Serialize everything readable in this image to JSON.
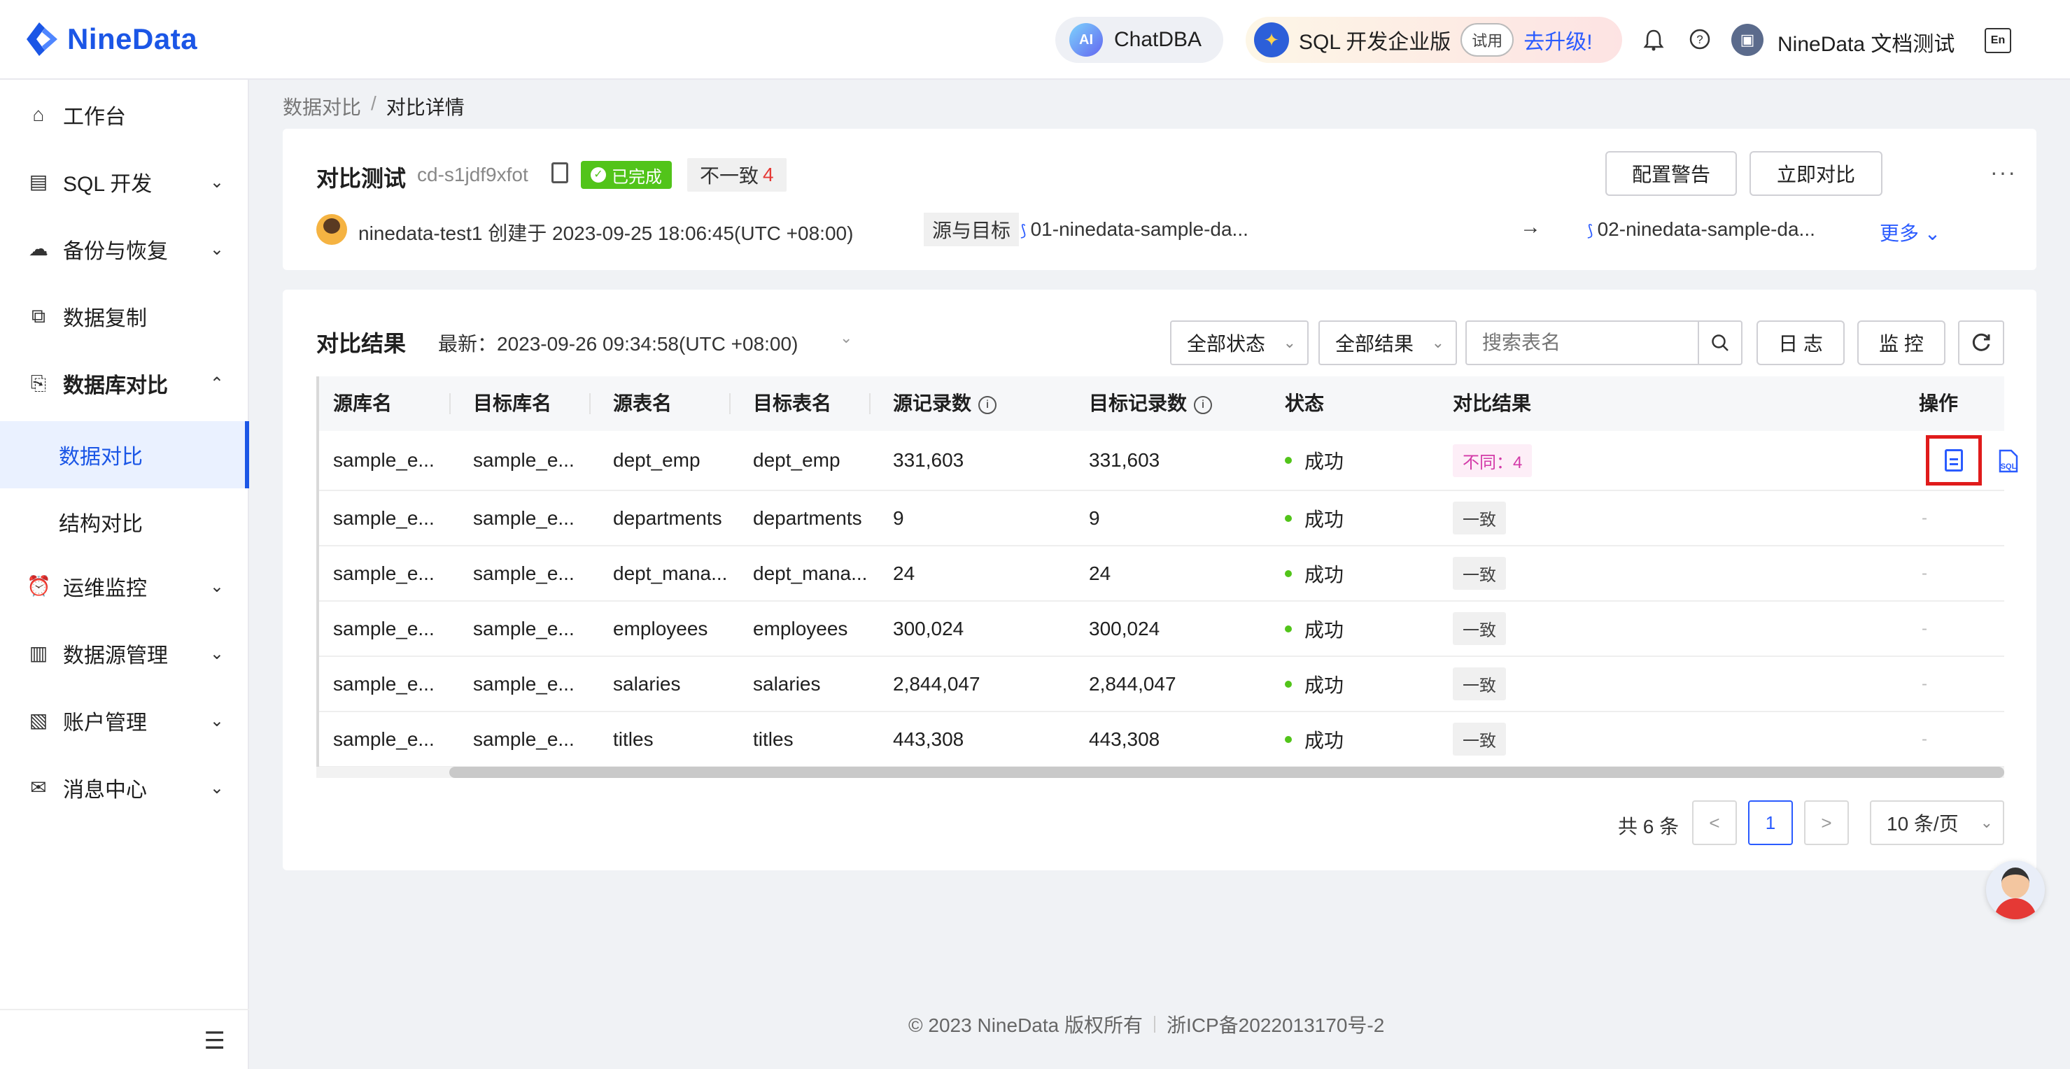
{
  "brand": {
    "name": "NineData"
  },
  "header": {
    "chatdba_label": "ChatDBA",
    "ai_badge": "AI",
    "edition_label": "SQL 开发企业版",
    "trial_tag": "试用",
    "upgrade_link": "去升级!",
    "user_name": "NineData 文档测试",
    "lang_icon_text": "En"
  },
  "sidebar": {
    "items": [
      {
        "label": "工作台",
        "icon": "home-icon"
      },
      {
        "label": "SQL 开发",
        "icon": "sql-icon"
      },
      {
        "label": "备份与恢复",
        "icon": "cloud-backup-icon"
      },
      {
        "label": "数据复制",
        "icon": "replication-icon"
      },
      {
        "label": "数据库对比",
        "icon": "compare-icon"
      },
      {
        "label": "数据对比"
      },
      {
        "label": "结构对比"
      },
      {
        "label": "运维监控",
        "icon": "alarm-icon"
      },
      {
        "label": "数据源管理",
        "icon": "datasource-icon"
      },
      {
        "label": "账户管理",
        "icon": "account-icon"
      },
      {
        "label": "消息中心",
        "icon": "mail-icon"
      }
    ]
  },
  "breadcrumb": {
    "parent": "数据对比",
    "separator": "/",
    "current": "对比详情"
  },
  "task": {
    "title": "对比测试",
    "id": "cd-s1jdf9xfot",
    "status": "已完成",
    "diff_label": "不一致",
    "diff_count": "4",
    "alert_button": "配置警告",
    "compare_button": "立即对比",
    "more_dots": "···",
    "creator": "ninedata-test1 创建于 2023-09-25 18:06:45(UTC +08:00)",
    "src_target_label": "源与目标",
    "source_db": "01-ninedata-sample-da...",
    "arrow": "→",
    "target_db": "02-ninedata-sample-da...",
    "more_link": "更多"
  },
  "results": {
    "title": "对比结果",
    "latest": "最新：2023-09-26 09:34:58(UTC +08:00)",
    "status_filter": "全部状态",
    "result_filter": "全部结果",
    "search_placeholder": "搜索表名",
    "log_button": "日 志",
    "monitor_button": "监 控",
    "columns": [
      "源库名",
      "目标库名",
      "源表名",
      "目标表名",
      "源记录数",
      "目标记录数",
      "状态",
      "对比结果",
      "操作"
    ],
    "rows": [
      {
        "src_db": "sample_e...",
        "tgt_db": "sample_e...",
        "src_table": "dept_emp",
        "tgt_table": "dept_emp",
        "src_count": "331,603",
        "tgt_count": "331,603",
        "status": "成功",
        "result": "不同：4",
        "op": ""
      },
      {
        "src_db": "sample_e...",
        "tgt_db": "sample_e...",
        "src_table": "departments",
        "tgt_table": "departments",
        "src_count": "9",
        "tgt_count": "9",
        "status": "成功",
        "result": "一致",
        "op": "-"
      },
      {
        "src_db": "sample_e...",
        "tgt_db": "sample_e...",
        "src_table": "dept_mana...",
        "tgt_table": "dept_mana...",
        "src_count": "24",
        "tgt_count": "24",
        "status": "成功",
        "result": "一致",
        "op": "-"
      },
      {
        "src_db": "sample_e...",
        "tgt_db": "sample_e...",
        "src_table": "employees",
        "tgt_table": "employees",
        "src_count": "300,024",
        "tgt_count": "300,024",
        "status": "成功",
        "result": "一致",
        "op": "-"
      },
      {
        "src_db": "sample_e...",
        "tgt_db": "sample_e...",
        "src_table": "salaries",
        "tgt_table": "salaries",
        "src_count": "2,844,047",
        "tgt_count": "2,844,047",
        "status": "成功",
        "result": "一致",
        "op": "-"
      },
      {
        "src_db": "sample_e...",
        "tgt_db": "sample_e...",
        "src_table": "titles",
        "tgt_table": "titles",
        "src_count": "443,308",
        "tgt_count": "443,308",
        "status": "成功",
        "result": "一致",
        "op": "-"
      }
    ],
    "sql_icon_text": "SQL"
  },
  "pagination": {
    "total": "共 6 条",
    "prev": "<",
    "page": "1",
    "next": ">",
    "page_size": "10 条/页"
  },
  "footer": {
    "copyright": "© 2023 NineData 版权所有",
    "icp": "浙ICP备2022013170号-2"
  },
  "colors": {
    "brand": "#1b56e6",
    "success": "#52c41a",
    "danger": "#e53935",
    "highlight_box": "#e01b1b"
  }
}
